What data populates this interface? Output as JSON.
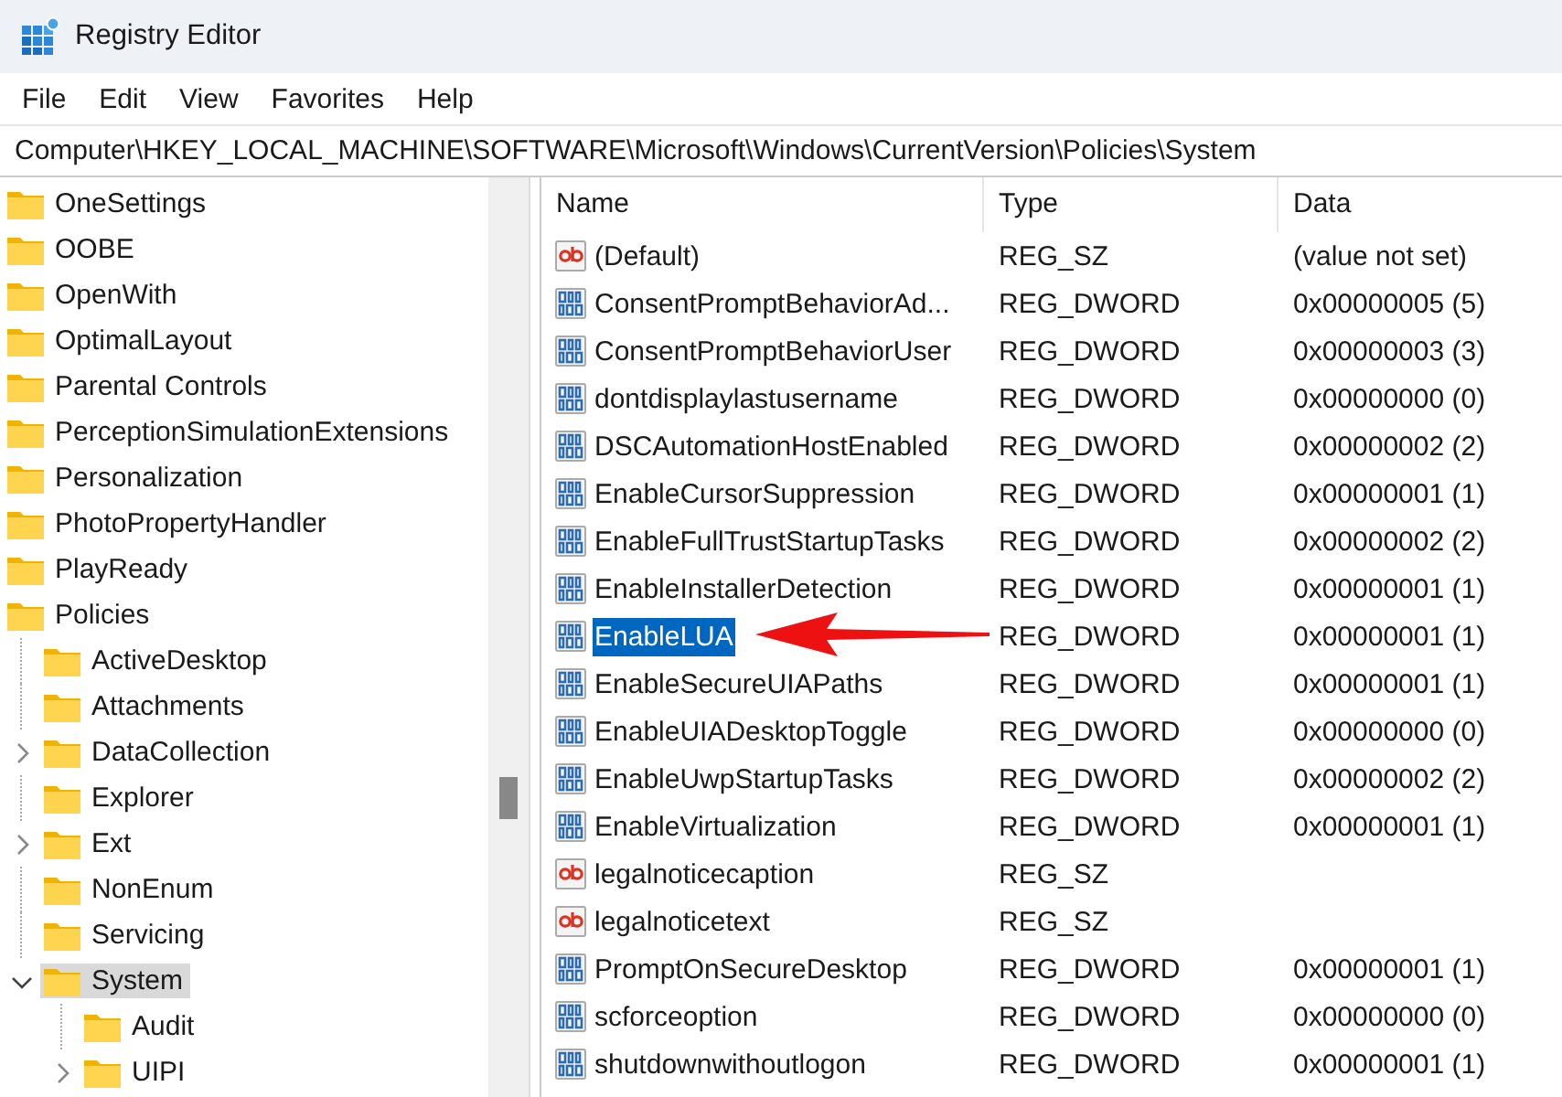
{
  "window": {
    "title": "Registry Editor"
  },
  "menu": [
    "File",
    "Edit",
    "View",
    "Favorites",
    "Help"
  ],
  "address": "Computer\\HKEY_LOCAL_MACHINE\\SOFTWARE\\Microsoft\\Windows\\CurrentVersion\\Policies\\System",
  "tree": [
    {
      "label": "OneSettings",
      "selected": false
    },
    {
      "label": "OOBE",
      "selected": false
    },
    {
      "label": "OpenWith",
      "selected": false
    },
    {
      "label": "OptimalLayout",
      "selected": false
    },
    {
      "label": "Parental Controls",
      "selected": false
    },
    {
      "label": "PerceptionSimulationExtensions",
      "selected": false
    },
    {
      "label": "Personalization",
      "selected": false
    },
    {
      "label": "PhotoPropertyHandler",
      "selected": false
    },
    {
      "label": "PlayReady",
      "selected": false
    },
    {
      "label": "Policies",
      "selected": false,
      "children": [
        {
          "label": "ActiveDesktop",
          "selected": false
        },
        {
          "label": "Attachments",
          "selected": false
        },
        {
          "label": "DataCollection",
          "selected": false,
          "expanded": false
        },
        {
          "label": "Explorer",
          "selected": false
        },
        {
          "label": "Ext",
          "selected": false,
          "expanded": false
        },
        {
          "label": "NonEnum",
          "selected": false
        },
        {
          "label": "Servicing",
          "selected": false
        },
        {
          "label": "System",
          "selected": true,
          "expanded": true,
          "children": [
            {
              "label": "Audit",
              "selected": false
            },
            {
              "label": "UIPI",
              "selected": false,
              "expanded": false
            }
          ]
        }
      ]
    }
  ],
  "values": {
    "columns": [
      "Name",
      "Type",
      "Data"
    ],
    "rows": [
      {
        "kind": "sz",
        "name": "(Default)",
        "type": "REG_SZ",
        "data": "(value not set)",
        "selected": false
      },
      {
        "kind": "dword",
        "name": "ConsentPromptBehaviorAd...",
        "type": "REG_DWORD",
        "data": "0x00000005 (5)",
        "selected": false
      },
      {
        "kind": "dword",
        "name": "ConsentPromptBehaviorUser",
        "type": "REG_DWORD",
        "data": "0x00000003 (3)",
        "selected": false
      },
      {
        "kind": "dword",
        "name": "dontdisplaylastusername",
        "type": "REG_DWORD",
        "data": "0x00000000 (0)",
        "selected": false
      },
      {
        "kind": "dword",
        "name": "DSCAutomationHostEnabled",
        "type": "REG_DWORD",
        "data": "0x00000002 (2)",
        "selected": false
      },
      {
        "kind": "dword",
        "name": "EnableCursorSuppression",
        "type": "REG_DWORD",
        "data": "0x00000001 (1)",
        "selected": false
      },
      {
        "kind": "dword",
        "name": "EnableFullTrustStartupTasks",
        "type": "REG_DWORD",
        "data": "0x00000002 (2)",
        "selected": false
      },
      {
        "kind": "dword",
        "name": "EnableInstallerDetection",
        "type": "REG_DWORD",
        "data": "0x00000001 (1)",
        "selected": false
      },
      {
        "kind": "dword",
        "name": "EnableLUA",
        "type": "REG_DWORD",
        "data": "0x00000001 (1)",
        "selected": true
      },
      {
        "kind": "dword",
        "name": "EnableSecureUIAPaths",
        "type": "REG_DWORD",
        "data": "0x00000001 (1)",
        "selected": false
      },
      {
        "kind": "dword",
        "name": "EnableUIADesktopToggle",
        "type": "REG_DWORD",
        "data": "0x00000000 (0)",
        "selected": false
      },
      {
        "kind": "dword",
        "name": "EnableUwpStartupTasks",
        "type": "REG_DWORD",
        "data": "0x00000002 (2)",
        "selected": false
      },
      {
        "kind": "dword",
        "name": "EnableVirtualization",
        "type": "REG_DWORD",
        "data": "0x00000001 (1)",
        "selected": false
      },
      {
        "kind": "sz",
        "name": "legalnoticecaption",
        "type": "REG_SZ",
        "selected": false
      },
      {
        "kind": "sz",
        "name": "legalnoticetext",
        "type": "REG_SZ",
        "selected": false
      },
      {
        "kind": "dword",
        "name": "PromptOnSecureDesktop",
        "type": "REG_DWORD",
        "data": "0x00000001 (1)",
        "selected": false
      },
      {
        "kind": "dword",
        "name": "scforceoption",
        "type": "REG_DWORD",
        "data": "0x00000000 (0)",
        "selected": false
      },
      {
        "kind": "dword",
        "name": "shutdownwithoutlogon",
        "type": "REG_DWORD",
        "data": "0x00000001 (1)",
        "selected": false
      }
    ]
  }
}
